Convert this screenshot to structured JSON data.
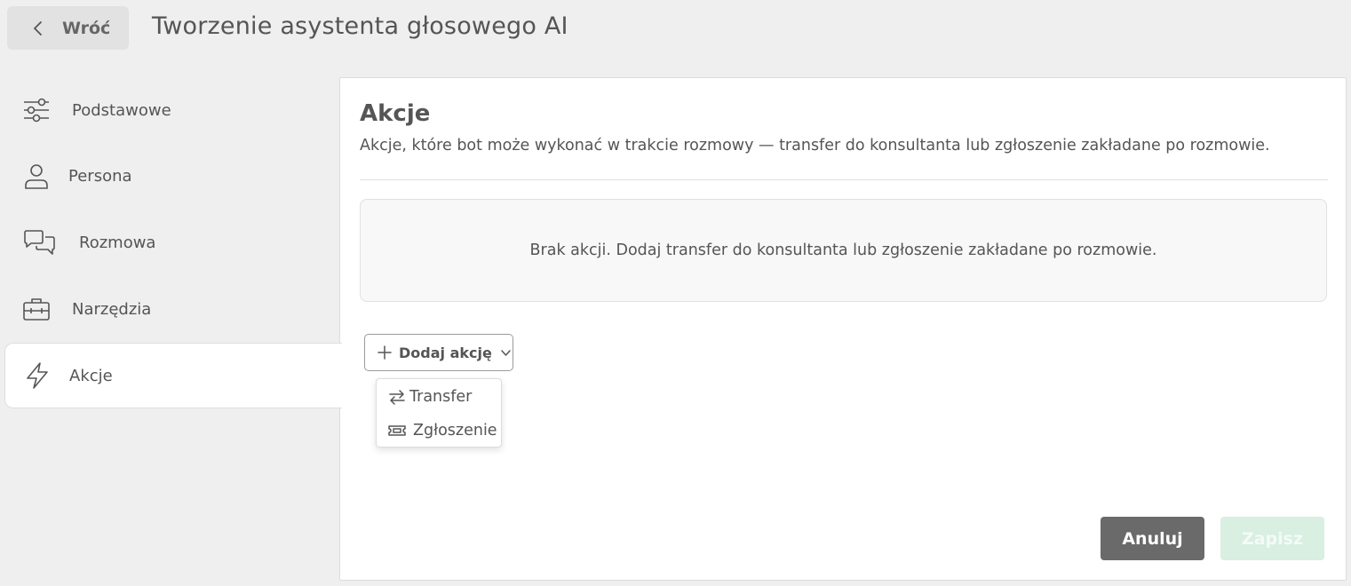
{
  "header": {
    "back_label": "Wróć",
    "title": "Tworzenie asystenta głosowego AI"
  },
  "sidebar": {
    "items": [
      {
        "label": "Podstawowe",
        "icon": "sliders-icon",
        "active": false
      },
      {
        "label": "Persona",
        "icon": "user-icon",
        "active": false
      },
      {
        "label": "Rozmowa",
        "icon": "chat-bubbles-icon",
        "active": false
      },
      {
        "label": "Narzędzia",
        "icon": "toolbox-icon",
        "active": false
      },
      {
        "label": "Akcje",
        "icon": "lightning-icon",
        "active": true
      }
    ]
  },
  "main": {
    "title": "Akcje",
    "description": "Akcje, które bot może wykonać w trakcie rozmowy — transfer do konsultanta lub zgłoszenie zakładane po rozmowie.",
    "empty_message": "Brak akcji. Dodaj transfer do konsultanta lub zgłoszenie zakładane po rozmowie.",
    "add_button_label": "Dodaj akcję",
    "dropdown": {
      "items": [
        {
          "label": "Transfer",
          "icon": "swap-arrows-icon"
        },
        {
          "label": "Zgłoszenie",
          "icon": "ticket-icon"
        }
      ]
    }
  },
  "footer": {
    "cancel_label": "Anuluj",
    "save_label": "Zapisz"
  },
  "colors": {
    "background": "#efefef",
    "panel": "#ffffff",
    "cancel_button": "#6a6a6a",
    "save_button_disabled": "#d8efe2",
    "text": "#555555"
  }
}
